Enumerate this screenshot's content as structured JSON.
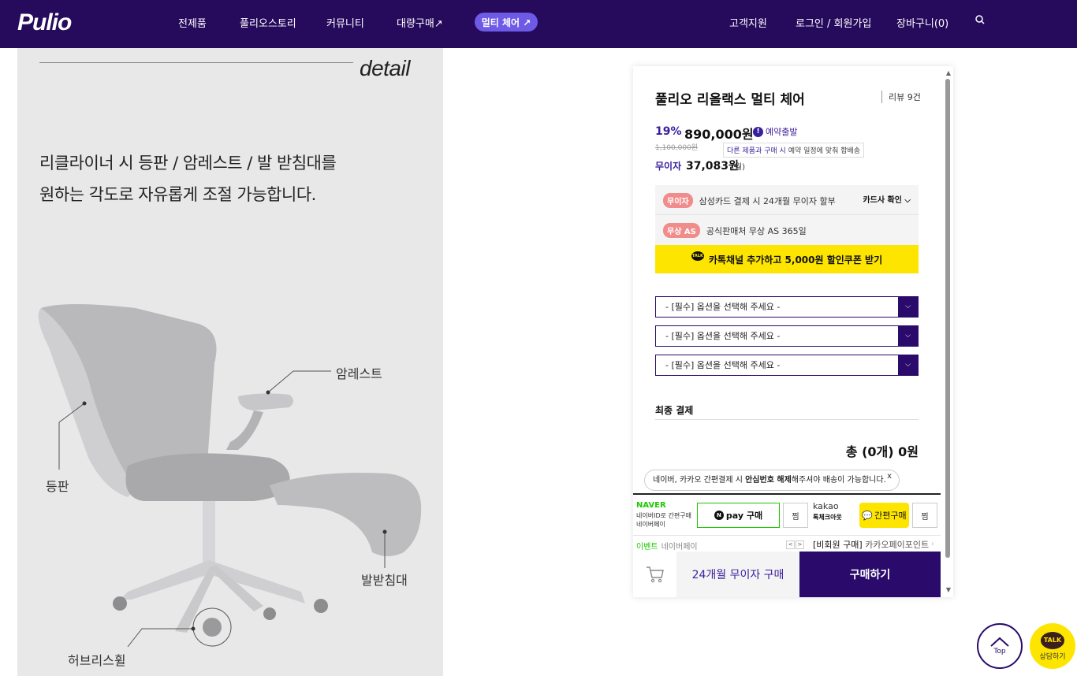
{
  "header": {
    "logo": "Pulio",
    "nav": [
      "전제품",
      "풀리오스토리",
      "커뮤니티",
      "대량구매↗"
    ],
    "nav_pill": "멀티 체어 ↗",
    "util": [
      "고객지원",
      "로그인 / 회원가입",
      "장바구니(0)"
    ],
    "search_icon": "search-icon"
  },
  "detail": {
    "word": "detail",
    "headline_line1": "리클라이너 시 등판 / 암레스트 / 발 받침대를",
    "headline_line2": "원하는 각도로 자유롭게 조절 가능합니다.",
    "callouts": {
      "armrest": "암레스트",
      "backrest": "등판",
      "footrest": "발받침대",
      "wheel": "허브리스휠"
    }
  },
  "product": {
    "title": "풀리오 리올랙스 멀티 체어",
    "review": "리뷰 9건",
    "discount": "19%",
    "price": "890,000원",
    "preorder": "예약출발",
    "original_price": "1,100,000원",
    "tip_highlight": "다른 제품과 구매 시",
    "tip_rest": " 예약 일정에 맞춰 합배송",
    "installment_label": "무이자",
    "installment_value": "37,083원",
    "installment_unit": "(월)",
    "benefits": [
      {
        "badge": "무이자",
        "text": "삼성카드 결제 시 24개월 무이자 할부",
        "action": "카드사 확인 ⌵"
      },
      {
        "badge": "무상 AS",
        "text": "공식판매처 무상 AS 365일"
      }
    ],
    "kakao_coupon": "카톡채널 추가하고 5,000원 할인쿠폰 받기",
    "options": [
      "- [필수] 옵션을 선택해 주세요 -",
      "- [필수] 옵션을 선택해 주세요 -",
      "- [필수] 옵션을 선택해 주세요 -"
    ],
    "final_label": "최종 결제",
    "total": "총 (0개) 0원",
    "notice_pre": "네이버, 카카오 간편결제 시 ",
    "notice_bold": "안심번호 해제",
    "notice_post": "해주셔야 배송이 가능합니다.",
    "notice_close": "x"
  },
  "easy_pay": {
    "naver_logo": "NAVER",
    "naver_sub1": "네이버ID로 간편구매",
    "naver_sub2": "네이버페이",
    "npay_label": "pay 구매",
    "zzim": "찜",
    "kakao_line1": "kakao",
    "kakao_line2": "톡체크아웃",
    "kpay_label": "간편구매",
    "event_label": "이벤트",
    "event_text": "네이버페이",
    "event2_label": "[비회원 구매]",
    "event2_text": " 카카오페이포인트"
  },
  "bottom_bar": {
    "installment_buy": "24개월 무이자 구매",
    "buy": "구매하기"
  },
  "floating": {
    "top": "Top",
    "talk": "TALK",
    "consult": "상담하기"
  }
}
